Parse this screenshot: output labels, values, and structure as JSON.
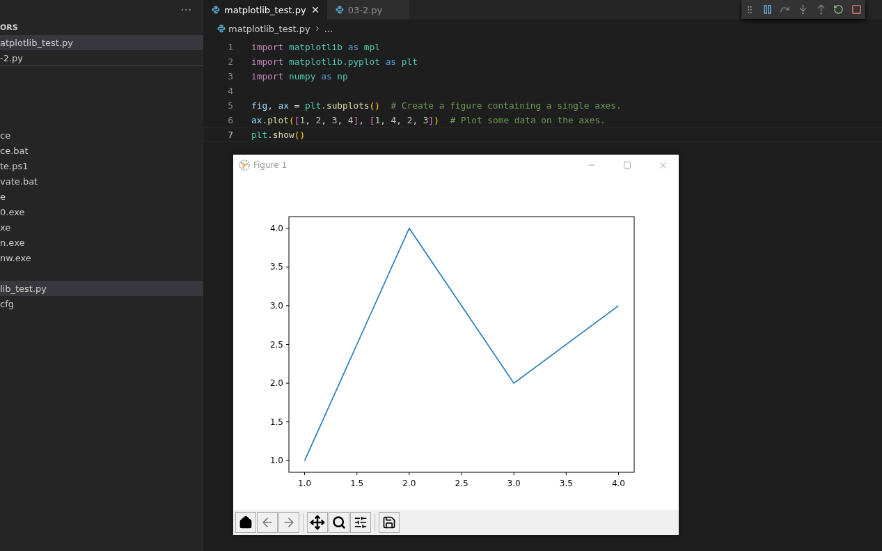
{
  "sidebar": {
    "more": "···",
    "section_title": "ORS",
    "open_editors": [
      {
        "label": "atplotlib_test.py",
        "selected": true
      },
      {
        "label": "-2.py",
        "selected": false
      }
    ],
    "files": [
      {
        "label": "ce",
        "selected": false
      },
      {
        "label": "ce.bat",
        "selected": false
      },
      {
        "label": "te.ps1",
        "selected": false
      },
      {
        "label": "vate.bat",
        "selected": false
      },
      {
        "label": "e",
        "selected": false
      },
      {
        "label": "0.exe",
        "selected": false
      },
      {
        "label": "xe",
        "selected": false
      },
      {
        "label": "n.exe",
        "selected": false
      },
      {
        "label": "nw.exe",
        "selected": false
      }
    ],
    "more_files": [
      {
        "label": "lib_test.py",
        "selected": true
      },
      {
        "label": "cfg",
        "selected": false
      }
    ]
  },
  "tabs": [
    {
      "label": "matplotlib_test.py",
      "selected": true
    },
    {
      "label": "03-2.py",
      "selected": false
    }
  ],
  "breadcrumb": {
    "file": "matplotlib_test.py",
    "rest": "..."
  },
  "code_lines": [
    {
      "number": "1",
      "current": false,
      "tokens": [
        {
          "text": "import",
          "kind": "control"
        },
        {
          "text": " matplotlib",
          "kind": "module"
        },
        {
          "text": " as",
          "kind": "keyword"
        },
        {
          "text": " mpl",
          "kind": "module"
        }
      ]
    },
    {
      "number": "2",
      "current": false,
      "tokens": [
        {
          "text": "import",
          "kind": "control"
        },
        {
          "text": " matplotlib.pyplot",
          "kind": "module"
        },
        {
          "text": " as",
          "kind": "keyword"
        },
        {
          "text": " plt",
          "kind": "module"
        }
      ]
    },
    {
      "number": "3",
      "current": false,
      "tokens": [
        {
          "text": "import",
          "kind": "control"
        },
        {
          "text": " numpy",
          "kind": "module"
        },
        {
          "text": " as",
          "kind": "keyword"
        },
        {
          "text": " np",
          "kind": "module"
        }
      ]
    },
    {
      "number": "4",
      "current": false
    },
    {
      "number": "5",
      "current": false,
      "tokens": [
        {
          "text": "fig",
          "kind": "variable"
        },
        {
          "text": ", ",
          "kind": "plain"
        },
        {
          "text": "ax",
          "kind": "variable"
        },
        {
          "text": " = ",
          "kind": "plain"
        },
        {
          "text": "plt",
          "kind": "module"
        },
        {
          "text": ".",
          "kind": "plain"
        },
        {
          "text": "subplots",
          "kind": "function"
        },
        {
          "text": "()",
          "kind": "bracket1"
        },
        {
          "text": "  # Create a figure containing a single axes.",
          "kind": "comment"
        }
      ]
    },
    {
      "number": "6",
      "current": false,
      "tokens": [
        {
          "text": "ax",
          "kind": "variable"
        },
        {
          "text": ".",
          "kind": "plain"
        },
        {
          "text": "plot",
          "kind": "function"
        },
        {
          "text": "(",
          "kind": "bracket1"
        },
        {
          "text": "[",
          "kind": "bracket2"
        },
        {
          "text": "1",
          "kind": "number"
        },
        {
          "text": ", ",
          "kind": "plain"
        },
        {
          "text": "2",
          "kind": "number"
        },
        {
          "text": ", ",
          "kind": "plain"
        },
        {
          "text": "3",
          "kind": "number"
        },
        {
          "text": ", ",
          "kind": "plain"
        },
        {
          "text": "4",
          "kind": "number"
        },
        {
          "text": "]",
          "kind": "bracket2"
        },
        {
          "text": ", ",
          "kind": "plain"
        },
        {
          "text": "[",
          "kind": "bracket2"
        },
        {
          "text": "1",
          "kind": "number"
        },
        {
          "text": ", ",
          "kind": "plain"
        },
        {
          "text": "4",
          "kind": "number"
        },
        {
          "text": ", ",
          "kind": "plain"
        },
        {
          "text": "2",
          "kind": "number"
        },
        {
          "text": ", ",
          "kind": "plain"
        },
        {
          "text": "3",
          "kind": "number"
        },
        {
          "text": "]",
          "kind": "bracket2"
        },
        {
          "text": ")",
          "kind": "bracket1"
        },
        {
          "text": "  # Plot some data on the axes.",
          "kind": "comment"
        }
      ]
    },
    {
      "number": "7",
      "current": true,
      "tokens": [
        {
          "text": "plt",
          "kind": "module"
        },
        {
          "text": ".",
          "kind": "plain"
        },
        {
          "text": "show",
          "kind": "function"
        },
        {
          "text": "()",
          "kind": "bracket1"
        }
      ]
    }
  ],
  "figure": {
    "title": "Figure 1",
    "chart_data": {
      "type": "line",
      "x": [
        1,
        2,
        3,
        4
      ],
      "series": [
        {
          "color": "#1f77b4",
          "values": [
            1,
            4,
            2,
            3
          ]
        }
      ],
      "xlim": [
        0.85,
        4.15
      ],
      "ylim": [
        0.85,
        4.15
      ],
      "xticks": [
        {
          "value": 1,
          "label": "1.0"
        },
        {
          "value": 1.5,
          "label": "1.5"
        },
        {
          "value": 2,
          "label": "2.0"
        },
        {
          "value": 2.5,
          "label": "2.5"
        },
        {
          "value": 3,
          "label": "3.0"
        },
        {
          "value": 3.5,
          "label": "3.5"
        },
        {
          "value": 4,
          "label": "4.0"
        }
      ],
      "yticks": [
        {
          "value": 1,
          "label": "1.0"
        },
        {
          "value": 1.5,
          "label": "1.5"
        },
        {
          "value": 2,
          "label": "2.0"
        },
        {
          "value": 2.5,
          "label": "2.5"
        },
        {
          "value": 3,
          "label": "3.0"
        },
        {
          "value": 3.5,
          "label": "3.5"
        },
        {
          "value": 4,
          "label": "4.0"
        }
      ]
    }
  }
}
